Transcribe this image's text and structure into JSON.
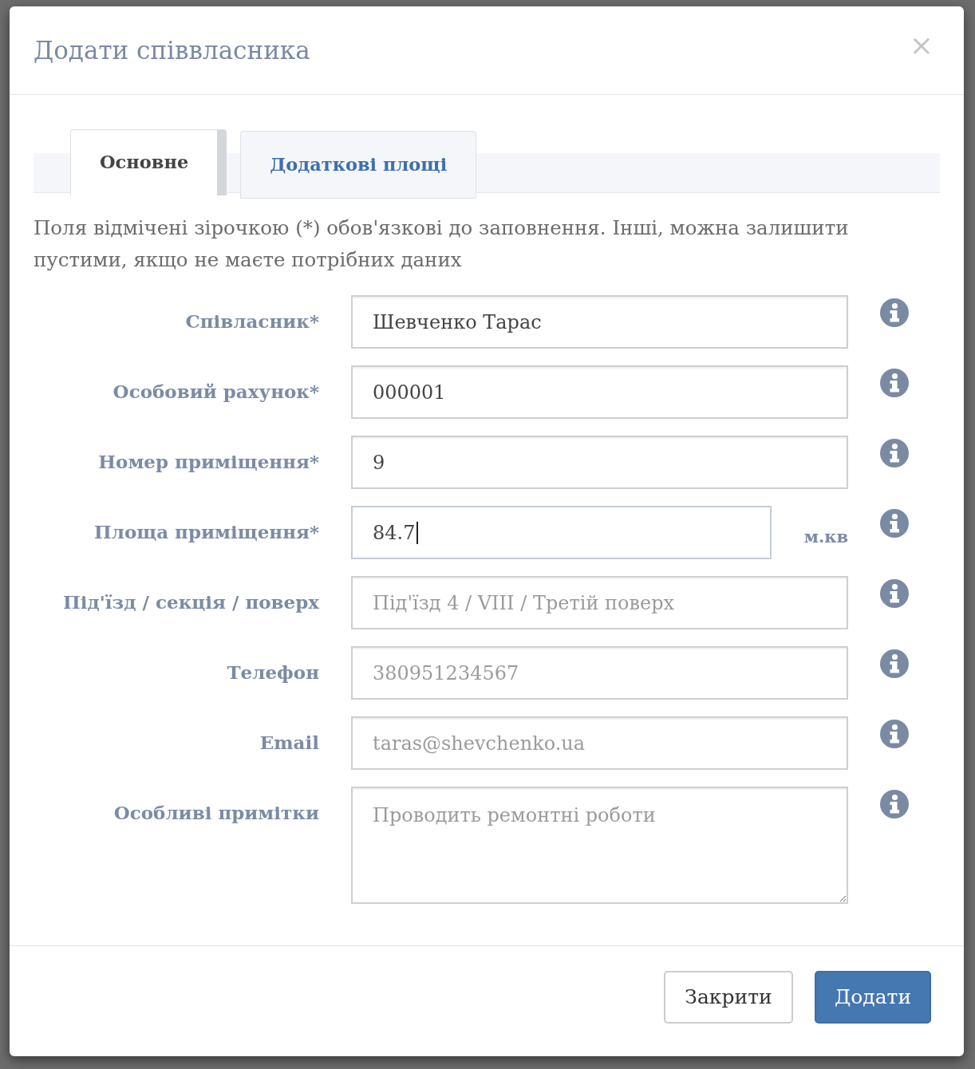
{
  "dialog": {
    "title": "Додати співвласника",
    "close": "×"
  },
  "tabs": [
    {
      "label": "Основне",
      "selected": true
    },
    {
      "label": "Додаткові площі",
      "selected": false
    }
  ],
  "note": "Поля відмічені зірочкою (*) обов'язкові до заповнення. Інші, можна залишити пустими, якщо не маєте потрібних даних",
  "fields": [
    {
      "kind": "text",
      "label": "Співласник*",
      "value": "Шевченко Тарас",
      "focused": false
    },
    {
      "kind": "text",
      "label": "Особовий рахунок*",
      "value": "000001",
      "focused": false
    },
    {
      "kind": "text",
      "label": "Номер приміщення*",
      "value": "9",
      "focused": false
    },
    {
      "kind": "text",
      "label": "Площа приміщення*",
      "value": "84.7",
      "unit": "м.кв",
      "focused": true
    },
    {
      "kind": "text",
      "label": "Під'їзд / секція / поверх",
      "placeholder": "Під'їзд 4 / VIII / Третій поверх",
      "focused": false
    },
    {
      "kind": "text",
      "label": "Телефон",
      "placeholder": "380951234567",
      "focused": false
    },
    {
      "kind": "text",
      "label": "Email",
      "placeholder": "taras@shevchenko.ua",
      "focused": false
    },
    {
      "kind": "textarea",
      "label": "Особливі примітки",
      "placeholder": "Проводить ремонтні роботи",
      "focused": false
    }
  ],
  "buttons": [
    {
      "label": "Закрити",
      "kind": "secondary"
    },
    {
      "label": "Додати",
      "kind": "primary"
    }
  ]
}
